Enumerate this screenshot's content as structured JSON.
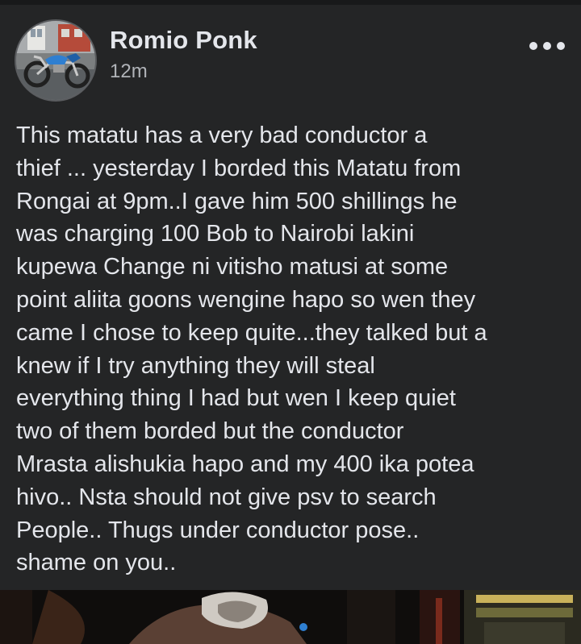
{
  "post": {
    "author": "Romio Ponk",
    "time": "12m",
    "more_icon": "more-horizontal-icon",
    "body": "This matatu has  a very bad conductor  a\nthief ... yesterday I borded this Matatu from\nRongai at 9pm..I gave him 500 shillings he\nwas charging 100 Bob to Nairobi lakini\nkupewa  Change  ni vitisho matusi at  some\npoint aliita goons wengine hapo so wen they\ncame I chose to keep quite...they talked but a\nknew if I try anything they will steal\neverything thing I had but wen I keep quiet\ntwo of them borded but the conductor\nMrasta alishukia hapo and my 400 ika potea\nhivo.. Nsta should not give psv to search\nPeople.. Thugs under conductor pose..\nshame on you.."
  },
  "colors": {
    "background": "#242526",
    "primary_text": "#e4e6eb",
    "secondary_text": "#b0b3b8",
    "motorbike_blue": "#2f7fd1"
  }
}
